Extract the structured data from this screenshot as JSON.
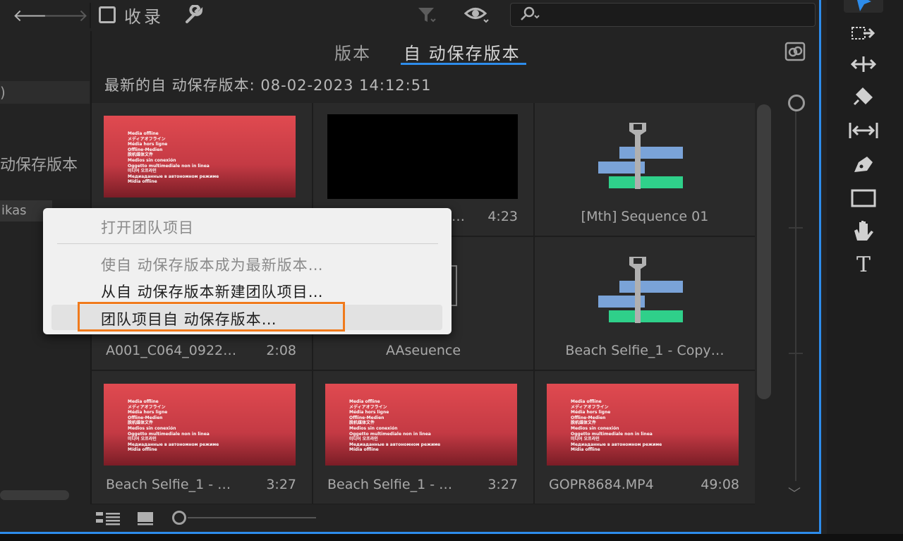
{
  "toolbar": {
    "bookmark_label": "收录",
    "search_placeholder": ""
  },
  "left": {
    "row1": ")",
    "row2": "动保存版本",
    "row3": "ikas"
  },
  "tabs": [
    {
      "label": "版本",
      "active": false
    },
    {
      "label": "自 动保存版本",
      "active": true
    }
  ],
  "latest_label": "最新的自 动保存版本: 08-02-2023 14:12:51",
  "offline_text": "Media offline\nメディアオフライン\nMédia hors ligne\nOffline-Medien\n脱机媒体文件\nMedios sin conexión\nOggetto multimediale non in linea\n미디어 오프라인\nМедиаданные в автономном режиме\nMídia offline",
  "tiles": [
    {
      "thumb": "red",
      "name": "",
      "duration": ""
    },
    {
      "thumb": "black",
      "name": "…",
      "duration": "4:23"
    },
    {
      "thumb": "sequence",
      "name": "[Mth] Sequence 01",
      "duration": ""
    },
    {
      "thumb": "none",
      "name": "A001_C064_0922…",
      "duration": "2:08"
    },
    {
      "thumb": "none",
      "name": "AAseuence",
      "duration": ""
    },
    {
      "thumb": "sequence",
      "name": "Beach Selfie_1 - Copy…",
      "duration": ""
    },
    {
      "thumb": "red",
      "name": "Beach Selfie_1 - …",
      "duration": "3:27"
    },
    {
      "thumb": "red",
      "name": "Beach Selfie_1 - …",
      "duration": "3:27"
    },
    {
      "thumb": "red",
      "name": "GOPR8684.MP4",
      "duration": "49:08"
    }
  ],
  "context_menu": {
    "items": [
      {
        "label": "打开团队项目",
        "enabled": false
      },
      {
        "label": "使自 动保存版本成为最新版本…",
        "enabled": false
      },
      {
        "label": "从自 动保存版本新建团队项目…",
        "enabled": true
      },
      {
        "label": "团队项目自 动保存版本…",
        "enabled": true,
        "highlighted": true
      }
    ]
  },
  "colors": {
    "accent": "#2d8ceb",
    "highlight": "#f07a1c",
    "sequence_blue": "#7aa3d8",
    "sequence_green": "#2fd08a"
  }
}
